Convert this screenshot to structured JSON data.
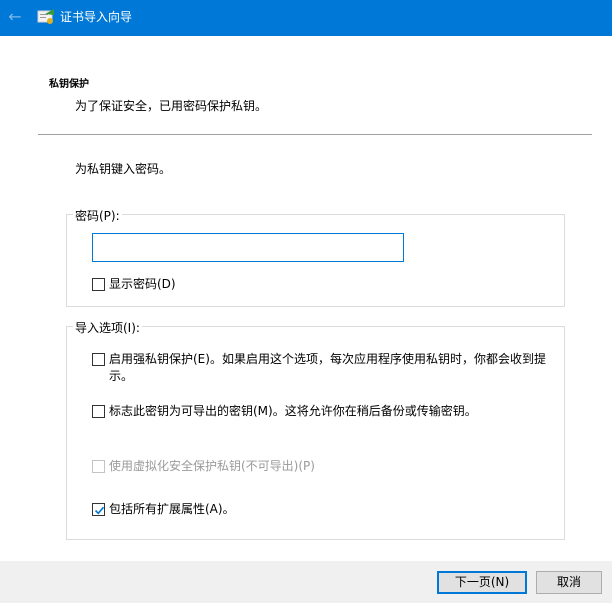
{
  "window": {
    "title": "证书导入向导"
  },
  "page": {
    "heading": "私钥保护",
    "subheading": "为了保证安全，已用密码保护私钥。",
    "prompt": "为私钥键入密码。"
  },
  "password_group": {
    "legend": "密码(P):",
    "value": "",
    "show_password": {
      "label": "显示密码(D)",
      "checked": false
    }
  },
  "import_options": {
    "legend": "导入选项(I):",
    "options": [
      {
        "label_line1": "启用强私钥保护(E)。如果启用这个选项，每次应用程序使用私钥时，你都会收到提",
        "label_line2": "示。",
        "checked": false,
        "enabled": true
      },
      {
        "label": "标志此密钥为可导出的密钥(M)。这将允许你在稍后备份或传输密钥。",
        "checked": false,
        "enabled": true
      },
      {
        "label": "使用虚拟化安全保护私钥(不可导出)(P)",
        "checked": false,
        "enabled": false
      },
      {
        "label": "包括所有扩展属性(A)。",
        "checked": true,
        "enabled": true
      }
    ]
  },
  "buttons": {
    "next": "下一页(N)",
    "cancel": "取消"
  },
  "colors": {
    "accent": "#0078d7",
    "footer": "#f0f0f0"
  }
}
